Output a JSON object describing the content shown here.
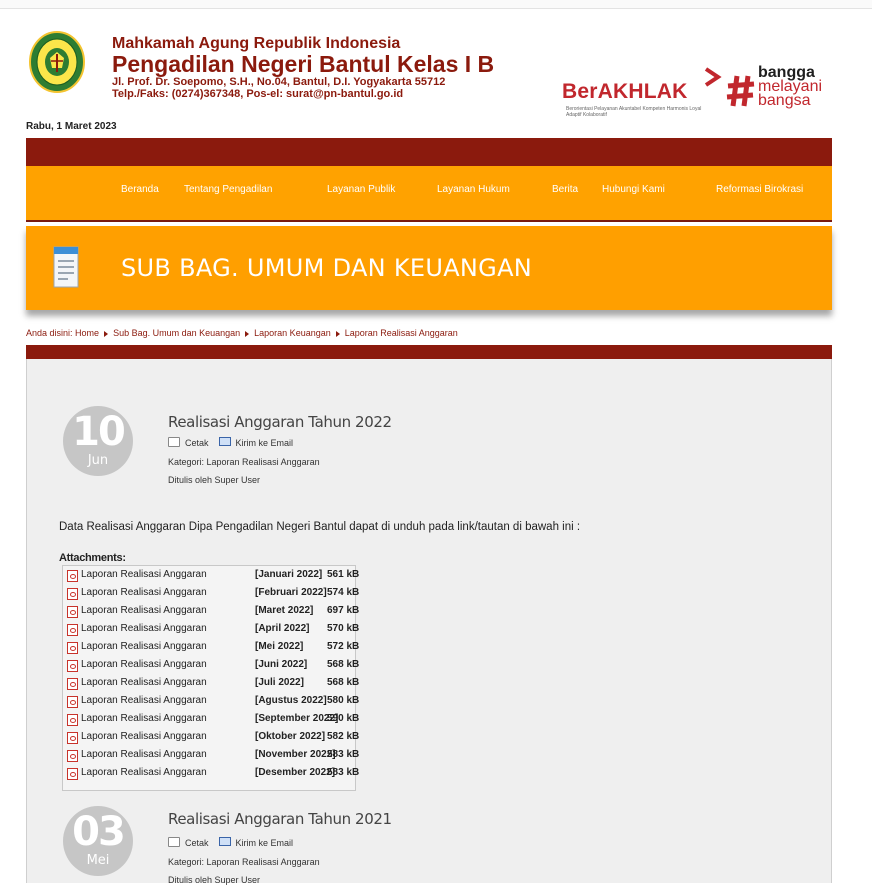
{
  "header": {
    "court_line1": "Mahkamah Agung Republik Indonesia",
    "court_line2": "Pengadilan Negeri Bantul Kelas I B",
    "court_line3": "Jl. Prof. Dr. Soepomo, S.H., No.04, Bantul, D.I. Yogyakarta 55712",
    "court_line4": "Telp./Faks: (0274)367348, Pos-el: surat@pn-bantul.go.id",
    "brand_name_a": "Ber",
    "brand_name_b": "AKHLAK",
    "brand_sub": "Berorientasi Pelayanan Akuntabel Kompeten Harmonis Loyal Adaptif Kolaboratif",
    "slogan_line1": "bangga",
    "slogan_line2": "melayani",
    "slogan_line3": "bangsa",
    "date": "Rabu, 1 Maret 2023",
    "colors": {
      "maroon": "#8b1a0d",
      "orange": "#ffa200",
      "brand_red": "#c1272d"
    }
  },
  "nav": {
    "items": [
      "Beranda",
      "Tentang Pengadilan",
      "Layanan Publik",
      "Layanan Hukum",
      "Berita",
      "Hubungi Kami",
      "Reformasi Birokrasi"
    ]
  },
  "banner": {
    "icon": "document-icon",
    "title": "SUB BAG. UMUM DAN KEUANGAN"
  },
  "breadcrumb": {
    "prefix": "Anda disini:",
    "items": [
      "Home",
      "Sub Bag. Umum dan Keuangan",
      "Laporan Keuangan",
      "Laporan Realisasi Anggaran"
    ]
  },
  "articles": [
    {
      "day": "10",
      "month": "Jun",
      "title": "Realisasi Anggaran Tahun 2022",
      "print_label": "Cetak",
      "email_label": "Kirim ke Email",
      "category": "Kategori: Laporan Realisasi Anggaran",
      "author": "Ditulis oleh Super User",
      "intro": "Data Realisasi Anggaran Dipa Pengadilan Negeri Bantul dapat di unduh pada link/tautan di bawah ini :",
      "attachments_label": "Attachments:",
      "attachments": [
        {
          "name": "Laporan Realisasi Anggaran",
          "month": "[Januari 2022]",
          "size": "561 kB"
        },
        {
          "name": "Laporan Realisasi Anggaran",
          "month": "[Februari 2022]",
          "size": "574 kB"
        },
        {
          "name": "Laporan Realisasi Anggaran",
          "month": "[Maret 2022]",
          "size": "697 kB"
        },
        {
          "name": "Laporan Realisasi Anggaran",
          "month": "[April 2022]",
          "size": "570 kB"
        },
        {
          "name": "Laporan Realisasi Anggaran",
          "month": "[Mei 2022]",
          "size": "572 kB"
        },
        {
          "name": "Laporan Realisasi Anggaran",
          "month": "[Juni 2022]",
          "size": "568 kB"
        },
        {
          "name": "Laporan Realisasi Anggaran",
          "month": "[Juli 2022]",
          "size": "568 kB"
        },
        {
          "name": "Laporan Realisasi Anggaran",
          "month": "[Agustus 2022]",
          "size": "580 kB"
        },
        {
          "name": "Laporan Realisasi Anggaran",
          "month": "[September 2022]",
          "size": "590 kB"
        },
        {
          "name": "Laporan Realisasi Anggaran",
          "month": "[Oktober 2022]",
          "size": "582 kB"
        },
        {
          "name": "Laporan Realisasi Anggaran",
          "month": "[November 2022]",
          "size": "583 kB"
        },
        {
          "name": "Laporan Realisasi Anggaran",
          "month": "[Desember 2022]",
          "size": "583 kB"
        }
      ]
    },
    {
      "day": "03",
      "month": "Mei",
      "title": "Realisasi Anggaran Tahun 2021",
      "print_label": "Cetak",
      "email_label": "Kirim ke Email",
      "category": "Kategori: Laporan Realisasi Anggaran",
      "author": "Ditulis oleh Super User"
    }
  ]
}
